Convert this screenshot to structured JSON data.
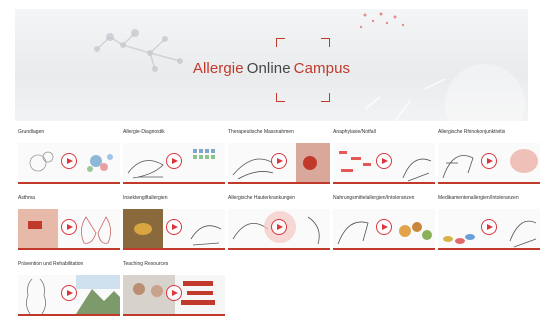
{
  "brand": {
    "part1": "Allergie",
    "part2": "Online",
    "part3": "Campus"
  },
  "tiles": [
    {
      "label": "Grundlagen",
      "icon": "molecule-illustration-icon"
    },
    {
      "label": "Allergie-Diagnostik",
      "icon": "skin-test-illustration-icon"
    },
    {
      "label": "Therapeutische Massnahmen",
      "icon": "injection-illustration-icon"
    },
    {
      "label": "Anaphylaxie/Notfall",
      "icon": "emergency-illustration-icon"
    },
    {
      "label": "Allergische Rhinokonjunktivitis",
      "icon": "nose-illustration-icon"
    },
    {
      "label": "Asthma",
      "icon": "inhaler-illustration-icon"
    },
    {
      "label": "Insektengiftallergien",
      "icon": "bee-illustration-icon"
    },
    {
      "label": "Allergische Hauterkrankungen",
      "icon": "skin-illustration-icon"
    },
    {
      "label": "Nahrungsmittelallergien/Intoleranzen",
      "icon": "food-illustration-icon"
    },
    {
      "label": "Medikamentenallergien/Intoleranzen",
      "icon": "pills-illustration-icon"
    },
    {
      "label": "Prävention und Rehabilitation",
      "icon": "mountain-illustration-icon"
    },
    {
      "label": "Teaching Resources",
      "icon": "teaching-illustration-icon"
    }
  ],
  "colors": {
    "accent": "#c0392b",
    "play": "#d9363e"
  }
}
